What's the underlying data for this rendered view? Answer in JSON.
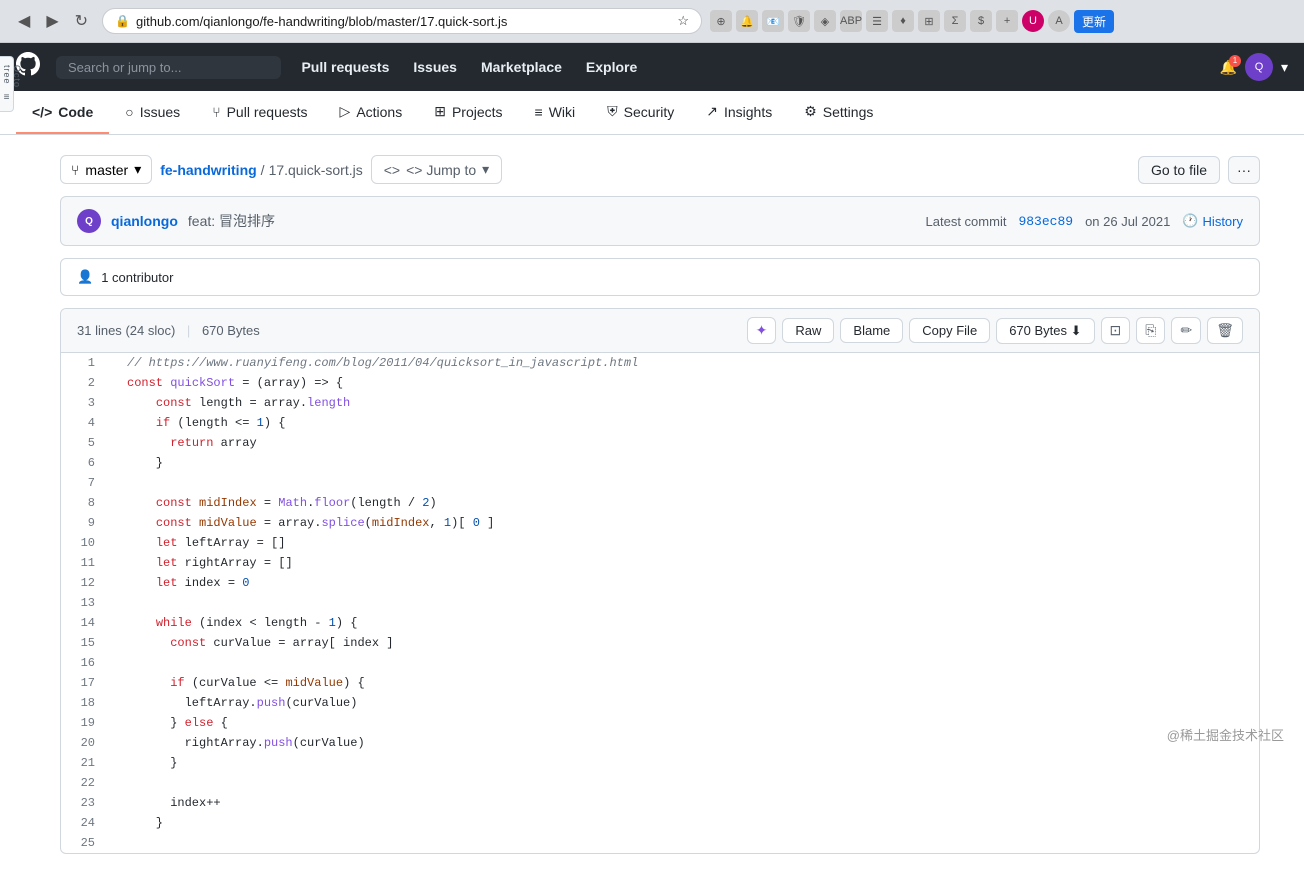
{
  "browser": {
    "url": "github.com/qianlongo/fe-handwriting/blob/master/17.quick-sort.js",
    "back_btn": "◀",
    "forward_btn": "▶",
    "refresh_btn": "↻",
    "update_btn": "更新"
  },
  "github_nav": {
    "logo": "⬡",
    "search_placeholder": "Search or jump to...",
    "items": [
      "Pull requests",
      "Issues",
      "Marketplace",
      "Explore"
    ]
  },
  "repo_nav": {
    "items": [
      {
        "label": "Code",
        "icon": "</>",
        "active": true
      },
      {
        "label": "Issues",
        "icon": "○"
      },
      {
        "label": "Pull requests",
        "icon": "⑂"
      },
      {
        "label": "Actions",
        "icon": "▷"
      },
      {
        "label": "Projects",
        "icon": "⊞"
      },
      {
        "label": "Wiki",
        "icon": "≡"
      },
      {
        "label": "Security",
        "icon": "⛨"
      },
      {
        "label": "Insights",
        "icon": "↗"
      },
      {
        "label": "Settings",
        "icon": "⚙"
      }
    ]
  },
  "file_path": {
    "branch": "master",
    "repo": "fe-handwriting",
    "separator": "/",
    "filename": "17.quick-sort.js",
    "jump_to": "<> Jump to",
    "go_to_file": "Go to file",
    "more_options": "···"
  },
  "commit": {
    "author": "qianlongo",
    "message": "feat: 冒泡排序",
    "prefix": "Latest commit",
    "hash": "983ec89",
    "date": "on 26 Jul 2021",
    "history": "History"
  },
  "contributor": {
    "icon": "👤",
    "text": "1 contributor"
  },
  "file_header": {
    "lines": "31 lines",
    "sloc": "(24 sloc)",
    "size": "670 Bytes",
    "raw": "Raw",
    "blame": "Blame",
    "copy_file": "Copy File",
    "size_btn": "670 Bytes"
  },
  "code_lines": [
    {
      "num": 1,
      "code": "// https://www.ruanyifeng.com/blog/2011/04/quicksort_in_javascript.html",
      "type": "comment"
    },
    {
      "num": 2,
      "code": "const quickSort = (array) => {",
      "type": "code"
    },
    {
      "num": 3,
      "code": "    const length = array.length",
      "type": "code"
    },
    {
      "num": 4,
      "code": "    if (length <= 1) {",
      "type": "code"
    },
    {
      "num": 5,
      "code": "      return array",
      "type": "code"
    },
    {
      "num": 6,
      "code": "    }",
      "type": "code"
    },
    {
      "num": 7,
      "code": "",
      "type": "empty"
    },
    {
      "num": 8,
      "code": "    const midIndex = Math.floor(length / 2)",
      "type": "code"
    },
    {
      "num": 9,
      "code": "    const midValue = array.splice(midIndex, 1)[ 0 ]",
      "type": "code"
    },
    {
      "num": 10,
      "code": "    let leftArray = []",
      "type": "code"
    },
    {
      "num": 11,
      "code": "    let rightArray = []",
      "type": "code"
    },
    {
      "num": 12,
      "code": "    let index = 0",
      "type": "code"
    },
    {
      "num": 13,
      "code": "",
      "type": "empty"
    },
    {
      "num": 14,
      "code": "    while (index < length - 1) {",
      "type": "code"
    },
    {
      "num": 15,
      "code": "      const curValue = array[ index ]",
      "type": "code"
    },
    {
      "num": 16,
      "code": "",
      "type": "empty"
    },
    {
      "num": 17,
      "code": "      if (curValue <= midValue) {",
      "type": "code"
    },
    {
      "num": 18,
      "code": "        leftArray.push(curValue)",
      "type": "code"
    },
    {
      "num": 19,
      "code": "      } else {",
      "type": "code"
    },
    {
      "num": 20,
      "code": "        rightArray.push(curValue)",
      "type": "code"
    },
    {
      "num": 21,
      "code": "      }",
      "type": "code"
    },
    {
      "num": 22,
      "code": "",
      "type": "empty"
    },
    {
      "num": 23,
      "code": "      index++",
      "type": "code"
    },
    {
      "num": 24,
      "code": "    }",
      "type": "code"
    },
    {
      "num": 25,
      "code": "",
      "type": "empty"
    }
  ],
  "watermark": "@稀土掘金技术社区"
}
